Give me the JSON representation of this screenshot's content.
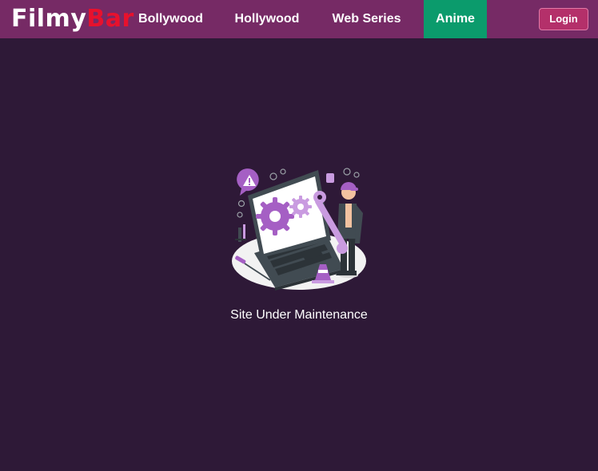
{
  "header": {
    "logo": {
      "part1": "Filmy",
      "part2": "Bar"
    },
    "nav": [
      {
        "label": "Bollywood",
        "active": false
      },
      {
        "label": "Hollywood",
        "active": false
      },
      {
        "label": "Web Series",
        "active": false
      },
      {
        "label": "Anime",
        "active": true
      }
    ],
    "login_label": "Login"
  },
  "main": {
    "illustration_icon": "maintenance-illustration",
    "status_text": "Site Under Maintenance"
  },
  "colors": {
    "navbar": "#762a65",
    "background": "#2e1937",
    "active_tab": "#0b9b6c",
    "login_button": "#b4306a",
    "logo_accent": "#e8112d",
    "illustration_accent": "#a55fc4"
  }
}
